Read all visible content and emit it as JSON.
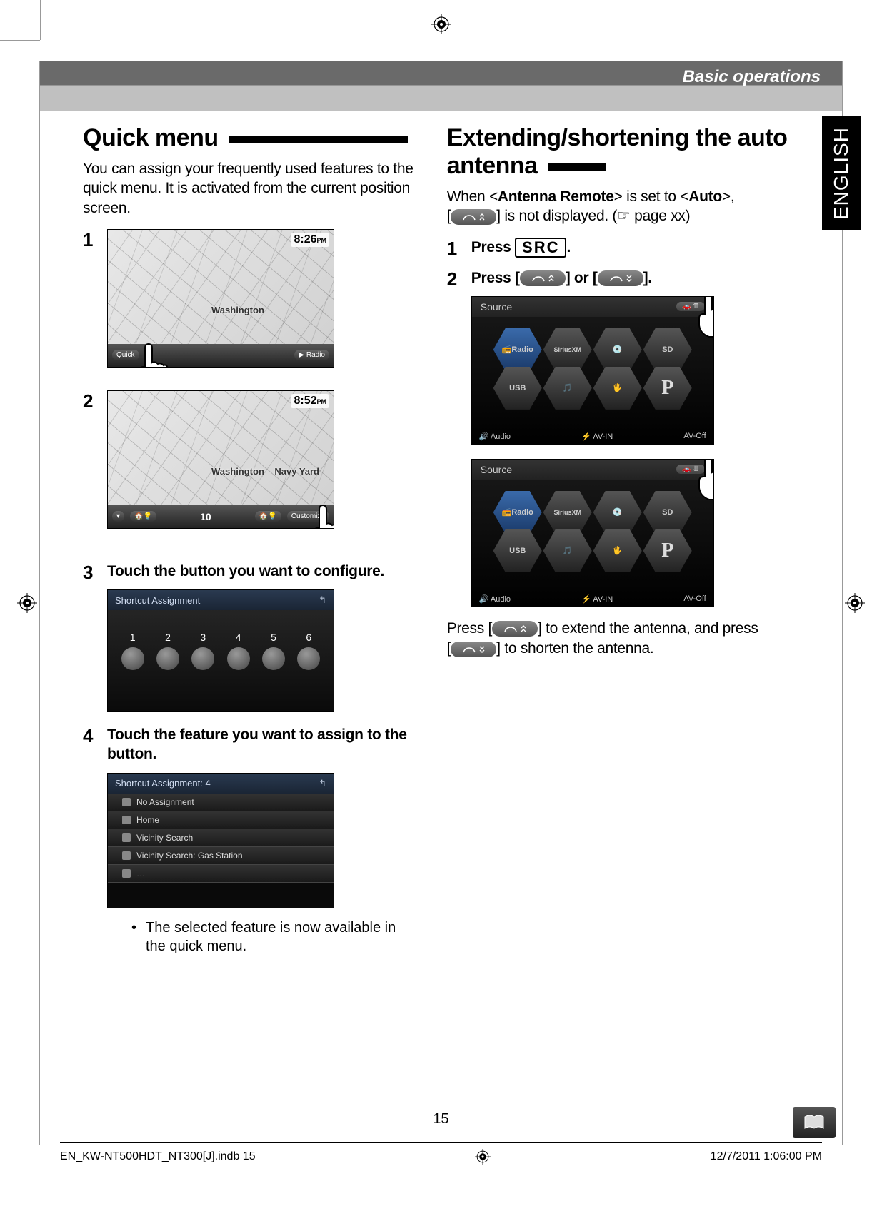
{
  "header": {
    "section": "Basic operations",
    "language_tab": "ENGLISH"
  },
  "left": {
    "title": "Quick menu",
    "intro": "You can assign your frequently used features to the quick menu. It is activated from the current position screen.",
    "map1": {
      "time": "8:26",
      "city": "Washington",
      "radio": "Radio",
      "quick": "Quick"
    },
    "map2": {
      "time": "8:52",
      "city": "Washington",
      "dist": "10",
      "custom": "Customize",
      "yard": "Navy Yard"
    },
    "step3": "Touch the button you want to configure.",
    "shortcut": {
      "title": "Shortcut Assignment",
      "slots": [
        "1",
        "2",
        "3",
        "4",
        "5",
        "6"
      ]
    },
    "step4": "Touch the feature you want to assign to the button.",
    "list": {
      "title": "Shortcut Assignment: 4",
      "items": [
        "No Assignment",
        "Home",
        "Vicinity Search",
        "Vicinity Search: Gas Station"
      ]
    },
    "bullet": "The selected feature is now available in the quick menu."
  },
  "right": {
    "title": "Extending/shortening the auto antenna",
    "intro_pre": "When <",
    "intro_b1": "Antenna Remote",
    "intro_mid": "> is set to <",
    "intro_b2": "Auto",
    "intro_post": ">,",
    "intro_line2_a": "[",
    "intro_line2_b": "] is not displayed. (☞ page xx)",
    "step1_a": "Press",
    "step1_btn": "SRC",
    "step1_b": ".",
    "step2_a": "Press [",
    "step2_b": "] or [",
    "step2_c": "].",
    "source": {
      "label": "Source",
      "hex": {
        "radio": "Radio",
        "disc": "Disc",
        "sd": "SD",
        "ipod": "iPod",
        "p": "P"
      },
      "footer": {
        "audio": "Audio",
        "avin": "AV-IN",
        "avoff": "AV-Off"
      }
    },
    "after_a": "Press [",
    "after_b": "] to extend the antenna, and press",
    "after_c": "[",
    "after_d": "] to shorten the antenna."
  },
  "footer": {
    "page_num": "15",
    "file": "EN_KW-NT500HDT_NT300[J].indb   15",
    "date": "12/7/2011   1:06:00 PM"
  }
}
